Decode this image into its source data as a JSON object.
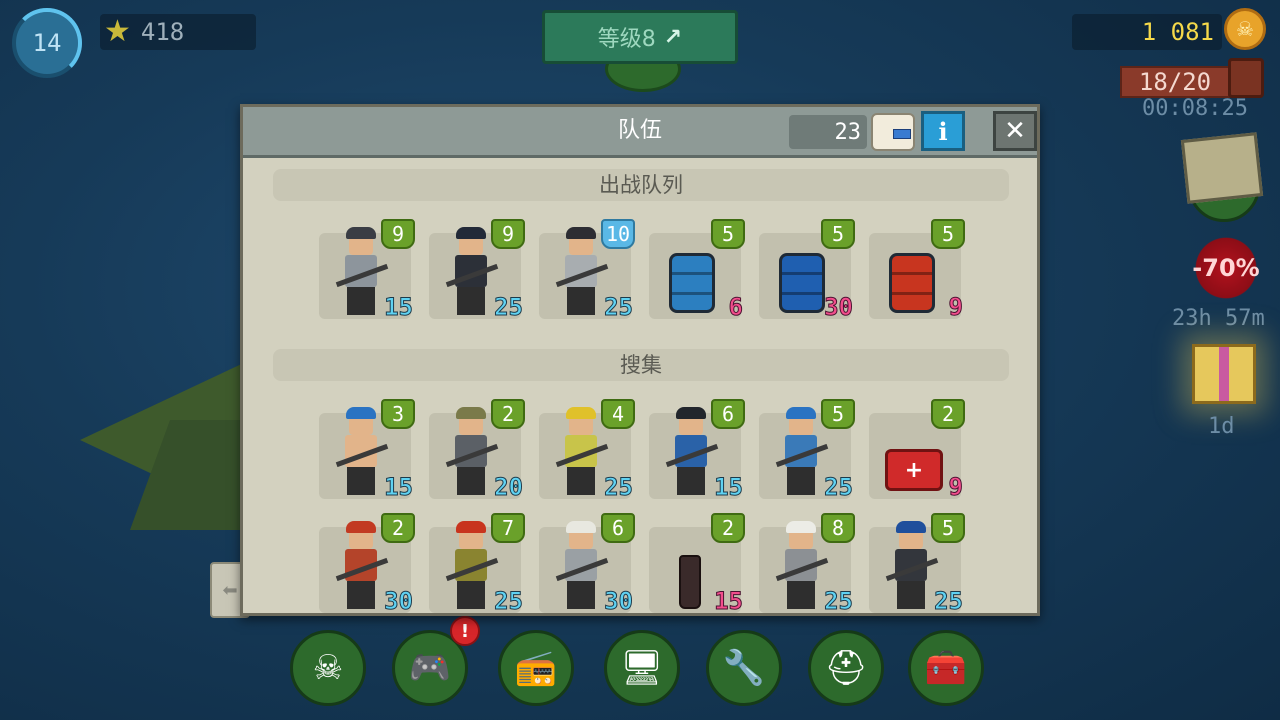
{
  "hud": {
    "player_level": "14",
    "stars": "418",
    "tier_label": "等级8",
    "coins": "1 081",
    "energy": "18/20",
    "energy_timer": "00:08:25",
    "discount": "-70%",
    "discount_timer": "23h 57m",
    "gift_timer": "1d"
  },
  "modal": {
    "title": "队伍",
    "tickets": "23",
    "info_label": "i",
    "close_label": "✕",
    "sections": [
      {
        "title": "出战队列",
        "cards": [
          {
            "kind": "survivor",
            "level": "9",
            "value": "15",
            "cap": "#3a3d44",
            "body": "#8d959c"
          },
          {
            "kind": "survivor",
            "level": "9",
            "value": "25",
            "cap": "#232a38",
            "body": "#2c3038"
          },
          {
            "kind": "survivor",
            "level": "10",
            "value": "25",
            "cap": "#2d2d33",
            "body": "#a8adb0",
            "level_style": "blue"
          },
          {
            "kind": "barrel",
            "level": "5",
            "value": "6",
            "color": "#2c7fc0",
            "value_style": "pink"
          },
          {
            "kind": "barrel",
            "level": "5",
            "value": "30",
            "color": "#1f5fb0",
            "value_style": "pink"
          },
          {
            "kind": "barrel",
            "level": "5",
            "value": "9",
            "color": "#c8351f",
            "value_style": "pink"
          }
        ]
      },
      {
        "title": "搜集",
        "cards": [
          {
            "kind": "survivor",
            "level": "3",
            "value": "15",
            "cap": "#2a73c2",
            "body": "#e2b48a"
          },
          {
            "kind": "survivor",
            "level": "2",
            "value": "20",
            "cap": "#7a7a4a",
            "body": "#5b6066"
          },
          {
            "kind": "survivor",
            "level": "4",
            "value": "25",
            "cap": "#e0c12a",
            "body": "#c8c44a"
          },
          {
            "kind": "survivor",
            "level": "6",
            "value": "15",
            "cap": "#22262c",
            "body": "#2a62a8"
          },
          {
            "kind": "survivor",
            "level": "5",
            "value": "25",
            "cap": "#2a73c2",
            "body": "#3a7ab8"
          },
          {
            "kind": "medkit",
            "level": "2",
            "value": "9",
            "value_style": "pink"
          },
          {
            "kind": "survivor",
            "level": "2",
            "value": "30",
            "cap": "#c23a22",
            "body": "#b4442a"
          },
          {
            "kind": "survivor",
            "level": "7",
            "value": "25",
            "cap": "#c8341e",
            "body": "#8a8430"
          },
          {
            "kind": "survivor",
            "level": "6",
            "value": "30",
            "cap": "#e8e8e0",
            "body": "#9aa0a4"
          },
          {
            "kind": "molotov",
            "level": "2",
            "value": "15",
            "value_style": "pink"
          },
          {
            "kind": "survivor",
            "level": "8",
            "value": "25",
            "cap": "#ecece6",
            "body": "#8c9094"
          },
          {
            "kind": "survivor",
            "level": "5",
            "value": "25",
            "cap": "#1f4f9c",
            "body": "#33363c"
          }
        ]
      }
    ]
  },
  "left_tab_label": "⬅",
  "nav": [
    {
      "name": "skull-emblem-button",
      "icon": "☠"
    },
    {
      "name": "gamepad-button",
      "icon": "🎮"
    },
    {
      "name": "radio-button",
      "icon": "📻"
    },
    {
      "name": "terminal-button",
      "icon": "🖥"
    },
    {
      "name": "workshop-button",
      "icon": "🔧"
    },
    {
      "name": "team-helmet-button",
      "icon": "⛑"
    },
    {
      "name": "chest-button",
      "icon": "🧰"
    }
  ],
  "nav_alert": "!"
}
